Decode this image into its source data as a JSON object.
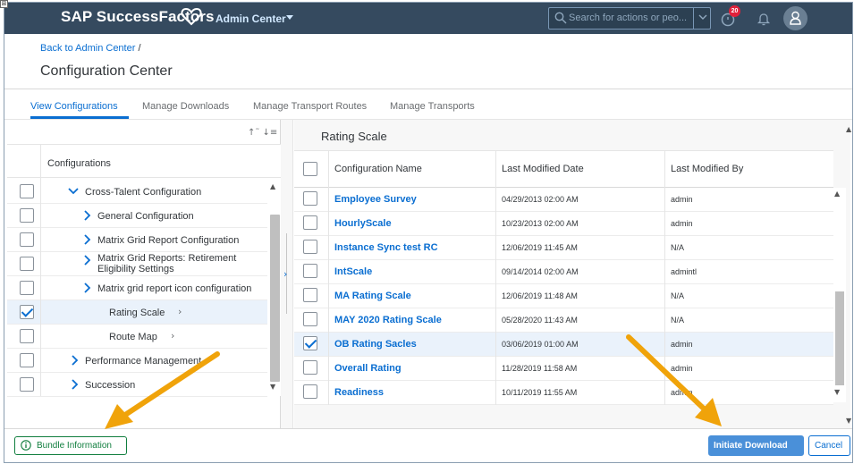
{
  "shell": {
    "brand": "SAP SuccessFactors",
    "admin_menu": "Admin Center",
    "search_placeholder": "Search for actions or peo...",
    "notification_count": "20"
  },
  "header": {
    "back_link": "Back to Admin Center",
    "back_separator": " /",
    "title": "Configuration Center"
  },
  "tabs": [
    {
      "label": "View Configurations",
      "active": true
    },
    {
      "label": "Manage Downloads",
      "active": false
    },
    {
      "label": "Manage Transport Routes",
      "active": false
    },
    {
      "label": "Manage Transports",
      "active": false
    }
  ],
  "left_panel": {
    "column_header": "Configurations",
    "rows": [
      {
        "label": "Cross-Talent Configuration",
        "expanded": true,
        "checked": false
      },
      {
        "label": "General Configuration",
        "expanded": false,
        "checked": false
      },
      {
        "label": "Matrix Grid Report Configuration",
        "expanded": false,
        "checked": false
      },
      {
        "label": "Matrix Grid Reports: Retirement Eligibility Settings",
        "expanded": false,
        "checked": false
      },
      {
        "label": "Matrix grid report icon configuration",
        "expanded": false,
        "checked": false
      },
      {
        "label": "Rating Scale",
        "leaf": true,
        "checked": true,
        "selected": true
      },
      {
        "label": "Route Map",
        "leaf": true,
        "checked": false
      },
      {
        "label": "Performance Management",
        "expanded": false,
        "checked": false
      },
      {
        "label": "Succession",
        "expanded": false,
        "checked": false
      }
    ]
  },
  "right_panel": {
    "title": "Rating Scale",
    "columns": [
      "Configuration Name",
      "Last Modified Date",
      "Last Modified By"
    ],
    "rows": [
      {
        "name": "Employee Survey",
        "date": "04/29/2013 02:00 AM",
        "by": "admin",
        "checked": false
      },
      {
        "name": "HourlyScale",
        "date": "10/23/2013 02:00 AM",
        "by": "admin",
        "checked": false
      },
      {
        "name": "Instance Sync test RC",
        "date": "12/06/2019 11:45 AM",
        "by": "N/A",
        "checked": false
      },
      {
        "name": "IntScale",
        "date": "09/14/2014 02:00 AM",
        "by": "admintl",
        "checked": false
      },
      {
        "name": "MA Rating Scale",
        "date": "12/06/2019 11:48 AM",
        "by": "N/A",
        "checked": false
      },
      {
        "name": "MAY 2020 Rating Scale",
        "date": "05/28/2020 11:43 AM",
        "by": "N/A",
        "checked": false
      },
      {
        "name": "OB Rating Sacles",
        "date": "03/06/2019 01:00 AM",
        "by": "admin",
        "checked": true
      },
      {
        "name": "Overall Rating",
        "date": "11/28/2019 11:58 AM",
        "by": "admin",
        "checked": false
      },
      {
        "name": "Readiness",
        "date": "10/11/2019 11:55 AM",
        "by": "admin",
        "checked": false
      }
    ]
  },
  "footer": {
    "bundle_info": "Bundle Information",
    "initiate_download": "Initiate Download",
    "cancel": "Cancel"
  },
  "colors": {
    "shell": "#354a5f",
    "link": "#0a6ed1",
    "accent_green": "#107e3e",
    "annotation_arrow": "#f0a30a"
  }
}
